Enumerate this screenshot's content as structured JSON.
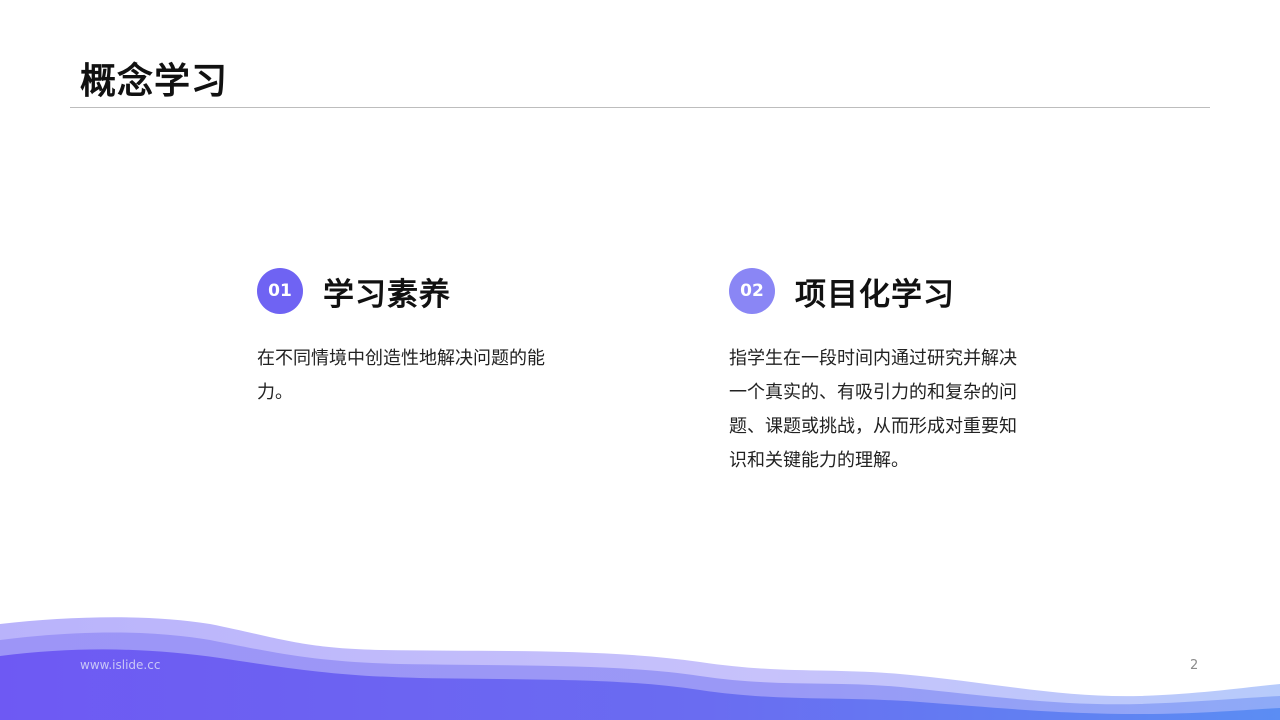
{
  "slide": {
    "title": "概念学习",
    "page_number": "2",
    "footer_url": "www.islide.cc"
  },
  "items": [
    {
      "number": "01",
      "title": "学习素养",
      "text": "在不同情境中创造性地解决问题的能力。"
    },
    {
      "number": "02",
      "title": "项目化学习",
      "text": "指学生在一段时间内通过研究并解决一个真实的、有吸引力的和复杂的问题、课题或挑战，从而形成对重要知识和关键能力的理解。"
    }
  ],
  "colors": {
    "accent_primary": "#6f63f3",
    "accent_secondary": "#8a86f5",
    "wave_light": "#b3aef8",
    "wave_mid": "#8f87f5",
    "wave_dark": "#6f63f3"
  }
}
